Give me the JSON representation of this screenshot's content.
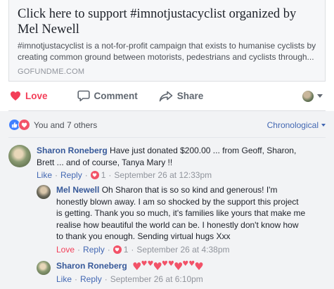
{
  "card": {
    "title_line1": "Click here to support #imnotjustacyclist organized by",
    "title_line2": "Mel Newell",
    "desc_line1": "#imnotjustacyclist is a not-for-profit campaign that exists to humanise cyclists by",
    "desc_line2": "creating common ground between motorists, pedestrians and cyclists through...",
    "domain": "GOFUNDME.COM"
  },
  "actions": {
    "love": "Love",
    "comment": "Comment",
    "share": "Share"
  },
  "reactions": {
    "summary": "You and 7 others",
    "sort": "Chronological"
  },
  "comments": [
    {
      "author": "Sharon Roneberg",
      "line1": "Have just donated $200.00 ... from Geoff, Sharon,",
      "line2": "Brett ... and of course, Tanya Mary !!",
      "like": "Like",
      "reply": "Reply",
      "reaction_count": "1",
      "time": "September 26 at 12:33pm"
    },
    {
      "author": "Mel Newell",
      "line1": "Oh Sharon that is so so kind and generous! I'm",
      "line2": "honestly blown away. I am so shocked by the support this project",
      "line3": "is getting. Thank you so much, it's families like yours that make me",
      "line4": "realise how beautiful the world can be. I honestly don't know how",
      "line5": "to thank you enough. Sending virtual hugs Xxx",
      "like": "Love",
      "reply": "Reply",
      "reaction_count": "1",
      "time": "September 26 at 4:38pm"
    },
    {
      "author": "Sharon Roneberg",
      "like": "Like",
      "reply": "Reply",
      "time": "September 26 at 6:10pm"
    }
  ],
  "colors": {
    "love": "#f33e58",
    "link": "#4267b2",
    "name": "#365899"
  }
}
